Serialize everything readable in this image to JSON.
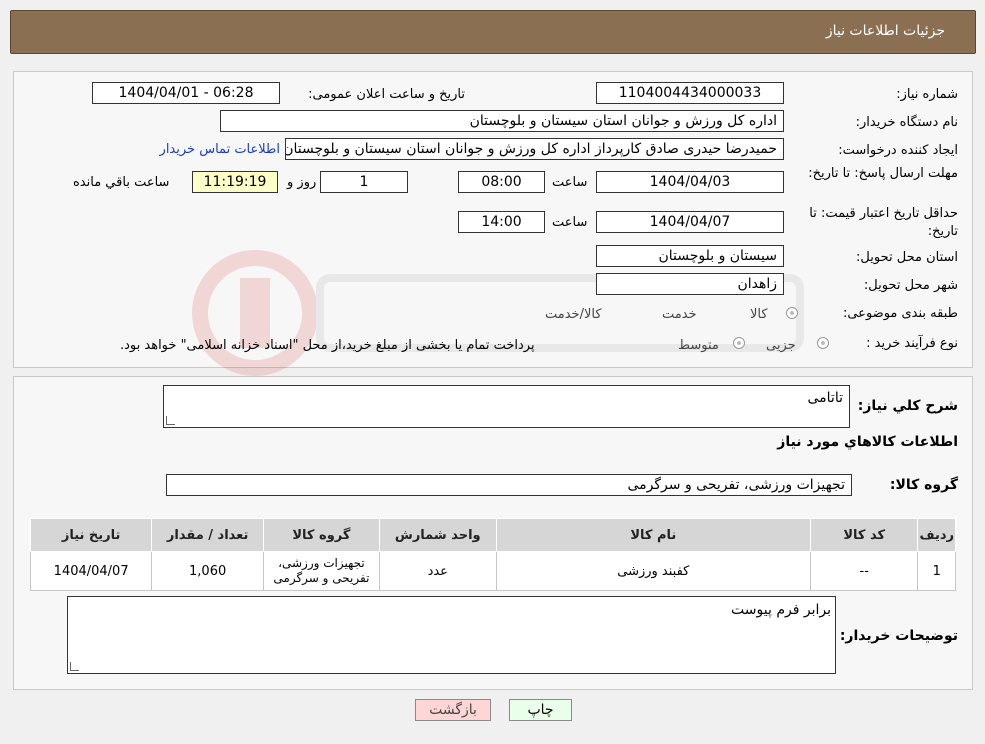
{
  "header": {
    "title": "جزئیات اطلاعات نیاز"
  },
  "form": {
    "need_number_label": "شماره نیاز:",
    "need_number": "1104004434000033",
    "announce_label": "تاریخ و ساعت اعلان عمومی:",
    "announce_value": "1404/04/01 - 06:28",
    "buyer_org_label": "نام دستگاه خریدار:",
    "buyer_org": "اداره کل ورزش و جوانان استان سیستان و بلوچستان",
    "requester_label": "ایجاد کننده درخواست:",
    "requester": "حمیدرضا حیدری صادق کارپرداز اداره کل ورزش و جوانان استان سیستان و بلوچستان",
    "contact_link": "اطلاعات تماس خریدار",
    "reply_deadline_label": "مهلت ارسال پاسخ: تا تاریخ:",
    "reply_date": "1404/04/03",
    "hour_label": "ساعت",
    "reply_time": "08:00",
    "days_value": "1",
    "days_label": "روز و",
    "remaining_time": "11:19:19",
    "remaining_label": "ساعت باقي مانده",
    "price_validity_label": "حداقل تاریخ اعتبار قیمت: تا تاریخ:",
    "price_date": "1404/04/07",
    "price_time": "14:00",
    "province_label": "استان محل تحویل:",
    "province": "سیستان و بلوچستان",
    "city_label": "شهر محل تحویل:",
    "city": "زاهدان",
    "category_label": "طبقه بندی موضوعی:",
    "category_options": [
      "کالا",
      "خدمت",
      "کالا/خدمت"
    ],
    "purchase_type_label": "نوع فرآیند خرید :",
    "purchase_options": [
      "جزیی",
      "متوسط"
    ],
    "purchase_note": "پرداخت تمام یا بخشی از مبلغ خرید،از محل \"اسناد خزانه اسلامی\" خواهد بود."
  },
  "details": {
    "summary_label": "شرح کلي نياز:",
    "summary": "تاتامی",
    "goods_info_title": "اطلاعات کالاهاي مورد نياز",
    "group_label": "گروه کالا:",
    "group_value": "تجهیزات ورزشی، تفریحی و سرگرمی",
    "table": {
      "headers": [
        "رديف",
        "کد کالا",
        "نام کالا",
        "واحد شمارش",
        "گروه کالا",
        "تعداد / مقدار",
        "تاریخ نیاز"
      ],
      "rows": [
        [
          "1",
          "--",
          "کفبند ورزشی",
          "عدد",
          "تجهیزات ورزشی، تفریحی و سرگرمی",
          "1,060",
          "1404/04/07"
        ]
      ]
    },
    "buyer_notes_label": "توضیحات خریدار:",
    "buyer_notes": "برابر فرم پیوست"
  },
  "buttons": {
    "print": "چاپ",
    "back": "بازگشت"
  },
  "colors": {
    "header_bg": "#8b6f52",
    "print_bg": "#eaffea",
    "back_bg": "#ffd6d6",
    "link": "#1a3dc7"
  }
}
